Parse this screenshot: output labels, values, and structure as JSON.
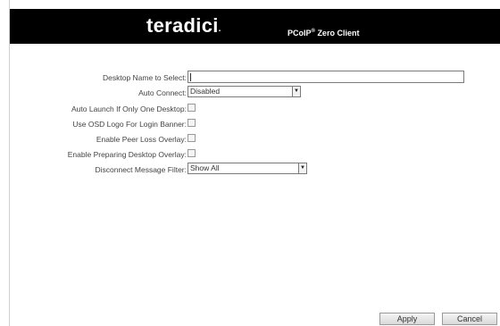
{
  "header": {
    "brand": "teradici",
    "brand_suffix": ".",
    "product_prefix": "PCoIP",
    "product_mark": "®",
    "product_suffix": " Zero Client"
  },
  "form": {
    "desktop_name": {
      "label": "Desktop Name to Select:",
      "value": ""
    },
    "auto_connect": {
      "label": "Auto Connect:",
      "value": "Disabled"
    },
    "auto_launch": {
      "label": "Auto Launch If Only One Desktop:",
      "checked": false
    },
    "osd_logo": {
      "label": "Use OSD Logo For Login Banner:",
      "checked": false
    },
    "peer_loss": {
      "label": "Enable Peer Loss Overlay:",
      "checked": false
    },
    "preparing_desktop": {
      "label": "Enable Preparing Desktop Overlay:",
      "checked": false
    },
    "disconnect_filter": {
      "label": "Disconnect Message Filter:",
      "value": "Show All"
    }
  },
  "buttons": {
    "apply": "Apply",
    "cancel": "Cancel"
  },
  "icons": {
    "dropdown": "chevron-down-icon"
  },
  "colors": {
    "header_bg": "#000000",
    "header_text": "#ffffff"
  }
}
